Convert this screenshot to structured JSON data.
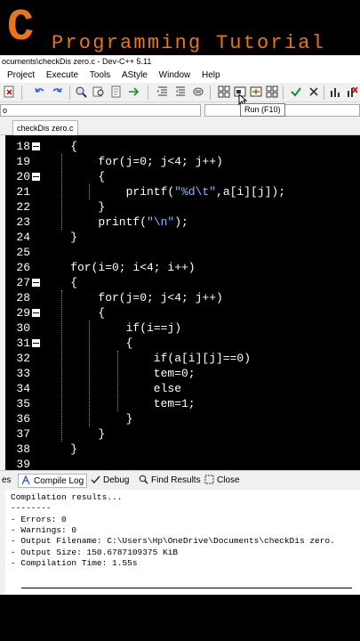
{
  "banner": {
    "logo_letter": "C",
    "title": "Programming Tutorial",
    "accent": "#e8751a"
  },
  "window": {
    "title": "ocuments\\checkDis zero.c - Dev-C++ 5.11"
  },
  "menu": [
    "Project",
    "Execute",
    "Tools",
    "AStyle",
    "Window",
    "Help"
  ],
  "toolbar": {
    "left_combo_value": "o",
    "tooltip": "Run (F10)"
  },
  "editor": {
    "tab_label": "checkDis zero.c",
    "lines": [
      {
        "n": "18",
        "fold": true,
        "indent": 2,
        "segments": [
          {
            "t": "{"
          }
        ]
      },
      {
        "n": "19",
        "fold": false,
        "indent": 3,
        "segments": [
          {
            "t": "for(j=0; j<4; j++)"
          }
        ]
      },
      {
        "n": "20",
        "fold": true,
        "indent": 3,
        "segments": [
          {
            "t": "{"
          }
        ]
      },
      {
        "n": "21",
        "fold": false,
        "indent": 4,
        "segments": [
          {
            "t": "printf("
          },
          {
            "t": "\"%d\\t\"",
            "s": true
          },
          {
            "t": ",a[i][j]);"
          }
        ]
      },
      {
        "n": "22",
        "fold": false,
        "indent": 3,
        "segments": [
          {
            "t": "}"
          }
        ]
      },
      {
        "n": "23",
        "fold": false,
        "indent": 3,
        "segments": [
          {
            "t": "printf("
          },
          {
            "t": "\"\\n\"",
            "s": true
          },
          {
            "t": ");"
          }
        ]
      },
      {
        "n": "24",
        "fold": false,
        "indent": 2,
        "segments": [
          {
            "t": "}"
          }
        ]
      },
      {
        "n": "25",
        "fold": false,
        "indent": 0,
        "segments": []
      },
      {
        "n": "26",
        "fold": false,
        "indent": 2,
        "segments": [
          {
            "t": "for(i=0; i<4; i++)"
          }
        ]
      },
      {
        "n": "27",
        "fold": true,
        "indent": 2,
        "segments": [
          {
            "t": "{"
          }
        ]
      },
      {
        "n": "28",
        "fold": false,
        "indent": 3,
        "segments": [
          {
            "t": "for(j=0; j<4; j++)"
          }
        ]
      },
      {
        "n": "29",
        "fold": true,
        "indent": 3,
        "segments": [
          {
            "t": "{"
          }
        ]
      },
      {
        "n": "30",
        "fold": false,
        "indent": 4,
        "segments": [
          {
            "t": "if(i==j)"
          }
        ]
      },
      {
        "n": "31",
        "fold": true,
        "indent": 4,
        "segments": [
          {
            "t": "{"
          }
        ]
      },
      {
        "n": "32",
        "fold": false,
        "indent": 5,
        "segments": [
          {
            "t": "if(a[i][j]==0)"
          }
        ]
      },
      {
        "n": "33",
        "fold": false,
        "indent": 5,
        "segments": [
          {
            "t": "tem=0;"
          }
        ]
      },
      {
        "n": "34",
        "fold": false,
        "indent": 5,
        "segments": [
          {
            "t": "else"
          }
        ]
      },
      {
        "n": "35",
        "fold": false,
        "indent": 5,
        "segments": [
          {
            "t": "tem=1;"
          }
        ]
      },
      {
        "n": "36",
        "fold": false,
        "indent": 4,
        "segments": [
          {
            "t": "}"
          }
        ]
      },
      {
        "n": "37",
        "fold": false,
        "indent": 3,
        "segments": [
          {
            "t": "}"
          }
        ]
      },
      {
        "n": "38",
        "fold": false,
        "indent": 2,
        "segments": [
          {
            "t": "}"
          }
        ]
      },
      {
        "n": "39",
        "fold": false,
        "indent": 0,
        "segments": []
      }
    ]
  },
  "panel": {
    "tabs": {
      "first": "es",
      "compile_log": "Compile Log",
      "debug": "Debug",
      "find_results": "Find Results",
      "close": "Close"
    },
    "output_lines": [
      "Compilation results...",
      "--------",
      "- Errors: 0",
      "- Warnings: 0",
      "- Output Filename: C:\\Users\\Hp\\OneDrive\\Documents\\checkDis zero.",
      "- Output Size: 150.6787109375 KiB",
      "- Compilation Time: 1.55s"
    ]
  }
}
